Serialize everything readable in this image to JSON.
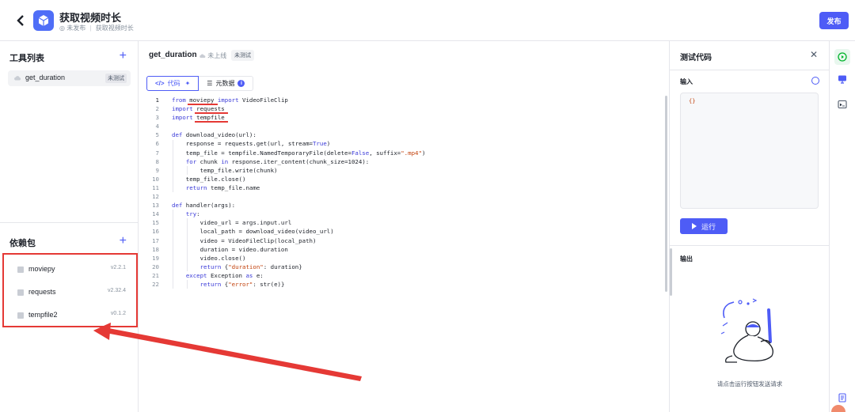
{
  "header": {
    "title": "获取视频时长",
    "status": "◎ 未发布",
    "breadcrumb": "获取视频时长",
    "publish_label": "发布"
  },
  "tools": {
    "title": "工具列表",
    "items": [
      {
        "name": "get_duration",
        "badge": "未测试"
      }
    ]
  },
  "deps": {
    "title": "依赖包",
    "items": [
      {
        "name": "moviepy",
        "version": "v2.2.1"
      },
      {
        "name": "requests",
        "version": "v2.32.4"
      },
      {
        "name": "tempfile2",
        "version": "v0.1.2"
      }
    ]
  },
  "editor": {
    "file_name": "get_duration",
    "file_status": "未上线",
    "file_badge": "未测试",
    "tabs": [
      "代码",
      "元数据"
    ],
    "lines": [
      "from moviepy import VideoFileClip",
      "import requests",
      "import tempfile",
      "",
      "def download_video(url):",
      "    response = requests.get(url, stream=True)",
      "    temp_file = tempfile.NamedTemporaryFile(delete=False, suffix=\".mp4\")",
      "    for chunk in response.iter_content(chunk_size=1024):",
      "        temp_file.write(chunk)",
      "    temp_file.close()",
      "    return temp_file.name",
      "",
      "def handler(args):",
      "    try:",
      "        video_url = args.input.url",
      "        local_path = download_video(video_url)",
      "        video = VideoFileClip(local_path)",
      "        duration = video.duration",
      "        video.close()",
      "        return {\"duration\": duration}",
      "    except Exception as e:",
      "        return {\"error\": str(e)}"
    ]
  },
  "test": {
    "title": "测试代码",
    "input_label": "输入",
    "input_value": "{}",
    "run_label": "运行",
    "output_label": "输出",
    "empty_hint": "请点击运行按钮发送请求"
  },
  "colors": {
    "accent": "#4e5cf6",
    "annotation": "#e53935"
  },
  "icons": {
    "back": "chevron-left-icon",
    "close": "close-icon",
    "code": "code-icon",
    "settings": "sliders-icon",
    "info": "info-icon"
  }
}
